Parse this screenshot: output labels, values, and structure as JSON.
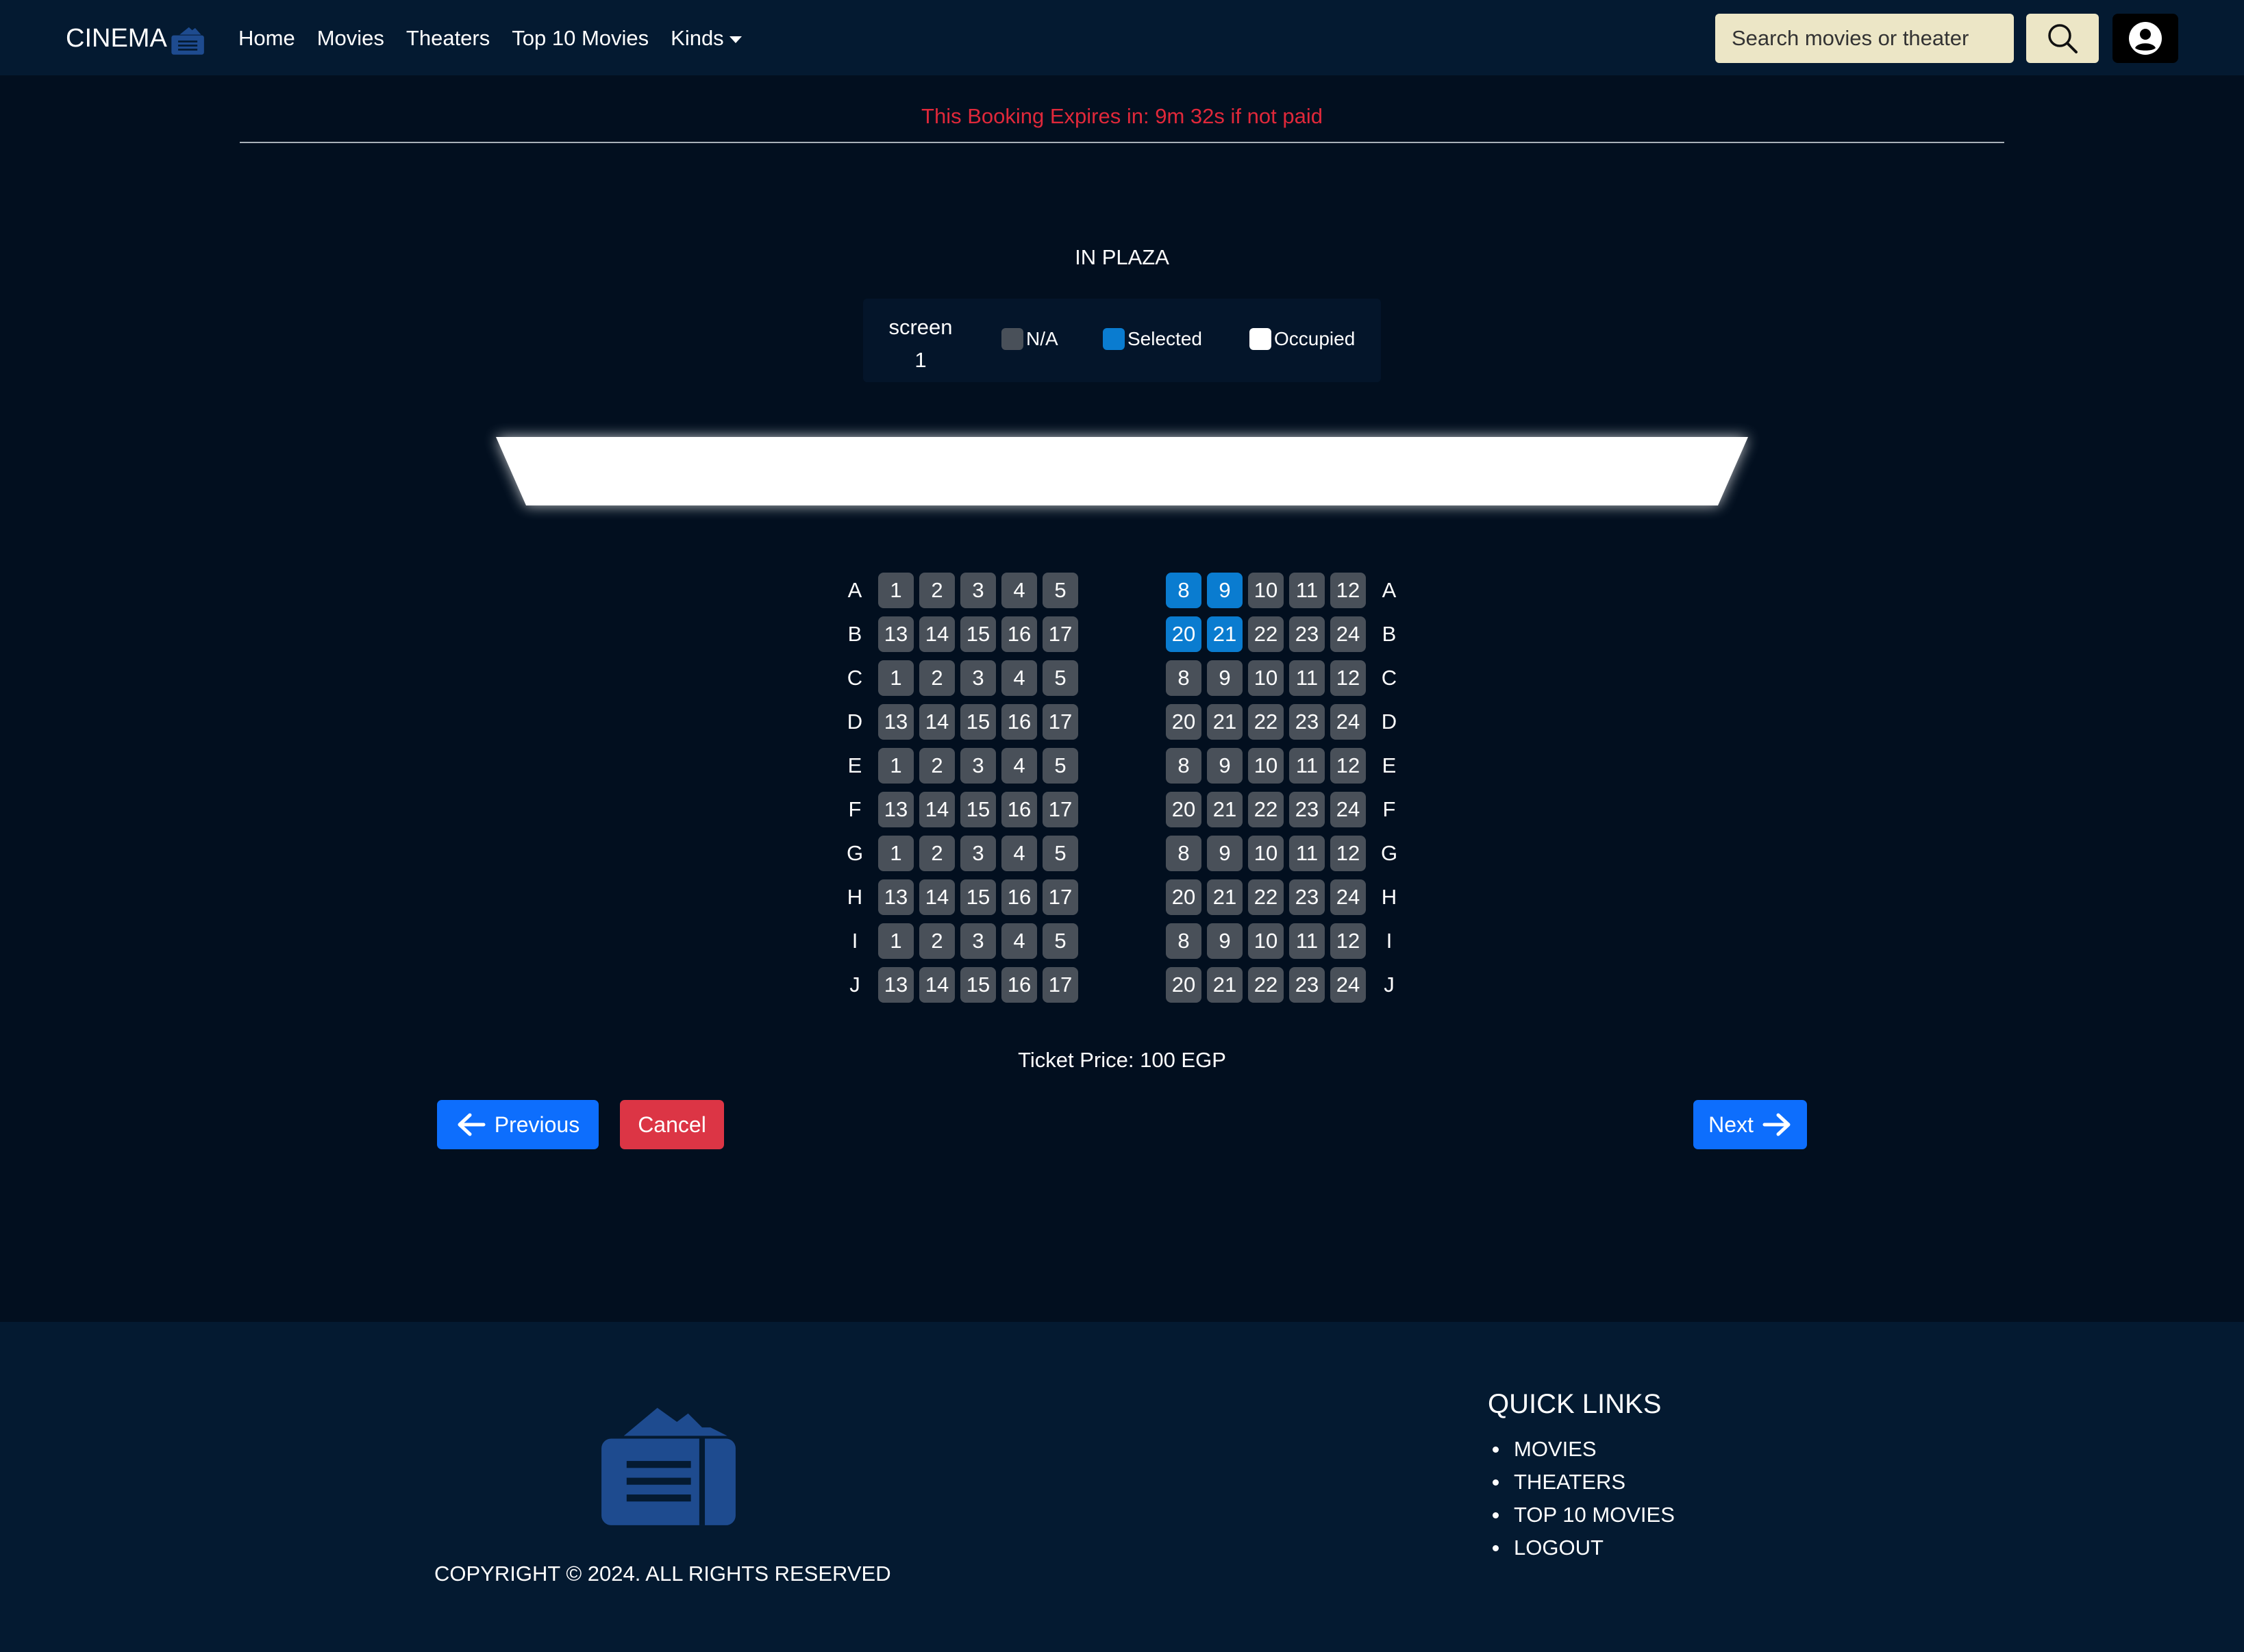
{
  "nav": {
    "brand": "CINEMA",
    "links": [
      "Home",
      "Movies",
      "Theaters",
      "Top 10 Movies",
      "Kinds"
    ],
    "search_placeholder": "Search movies or theater",
    "icons": {
      "brand": "ticket-icon",
      "search": "search-icon",
      "user": "user-circle-icon",
      "dropdown": "caret-down-icon"
    }
  },
  "timer": {
    "prefix": "This Booking Expires in:",
    "time": "9m 32s",
    "suffix": "if not paid"
  },
  "theater": {
    "name": "IN PLAZA",
    "screen_label": "screen",
    "screen_number": "1",
    "legend": [
      {
        "label": "N/A",
        "color": "#495059"
      },
      {
        "label": "Selected",
        "color": "#0a7cd0"
      },
      {
        "label": "Occupied",
        "color": "#ffffff"
      }
    ]
  },
  "seating": {
    "rows": [
      "A",
      "B",
      "C",
      "D",
      "E",
      "F",
      "G",
      "H",
      "I",
      "J"
    ],
    "left_seats": [
      [
        "1",
        "2",
        "3",
        "4",
        "5"
      ],
      [
        "13",
        "14",
        "15",
        "16",
        "17"
      ],
      [
        "1",
        "2",
        "3",
        "4",
        "5"
      ],
      [
        "13",
        "14",
        "15",
        "16",
        "17"
      ],
      [
        "1",
        "2",
        "3",
        "4",
        "5"
      ],
      [
        "13",
        "14",
        "15",
        "16",
        "17"
      ],
      [
        "1",
        "2",
        "3",
        "4",
        "5"
      ],
      [
        "13",
        "14",
        "15",
        "16",
        "17"
      ],
      [
        "1",
        "2",
        "3",
        "4",
        "5"
      ],
      [
        "13",
        "14",
        "15",
        "16",
        "17"
      ]
    ],
    "right_seats": [
      [
        "8",
        "9",
        "10",
        "11",
        "12"
      ],
      [
        "20",
        "21",
        "22",
        "23",
        "24"
      ],
      [
        "8",
        "9",
        "10",
        "11",
        "12"
      ],
      [
        "20",
        "21",
        "22",
        "23",
        "24"
      ],
      [
        "8",
        "9",
        "10",
        "11",
        "12"
      ],
      [
        "20",
        "21",
        "22",
        "23",
        "24"
      ],
      [
        "8",
        "9",
        "10",
        "11",
        "12"
      ],
      [
        "20",
        "21",
        "22",
        "23",
        "24"
      ],
      [
        "8",
        "9",
        "10",
        "11",
        "12"
      ],
      [
        "20",
        "21",
        "22",
        "23",
        "24"
      ]
    ],
    "selected": [
      "A-8",
      "A-9",
      "B-20",
      "B-21"
    ]
  },
  "ticket_price": "Ticket Price: 100 EGP",
  "actions": {
    "previous": "Previous",
    "cancel": "Cancel",
    "next": "Next"
  },
  "footer": {
    "copyright": "COPYRIGHT © 2024. ALL RIGHTS RESERVED",
    "quick_links_title": "QUICK LINKS",
    "quick_links": [
      "MOVIES",
      "THEATERS",
      "TOP 10 MOVIES",
      "LOGOUT"
    ]
  }
}
